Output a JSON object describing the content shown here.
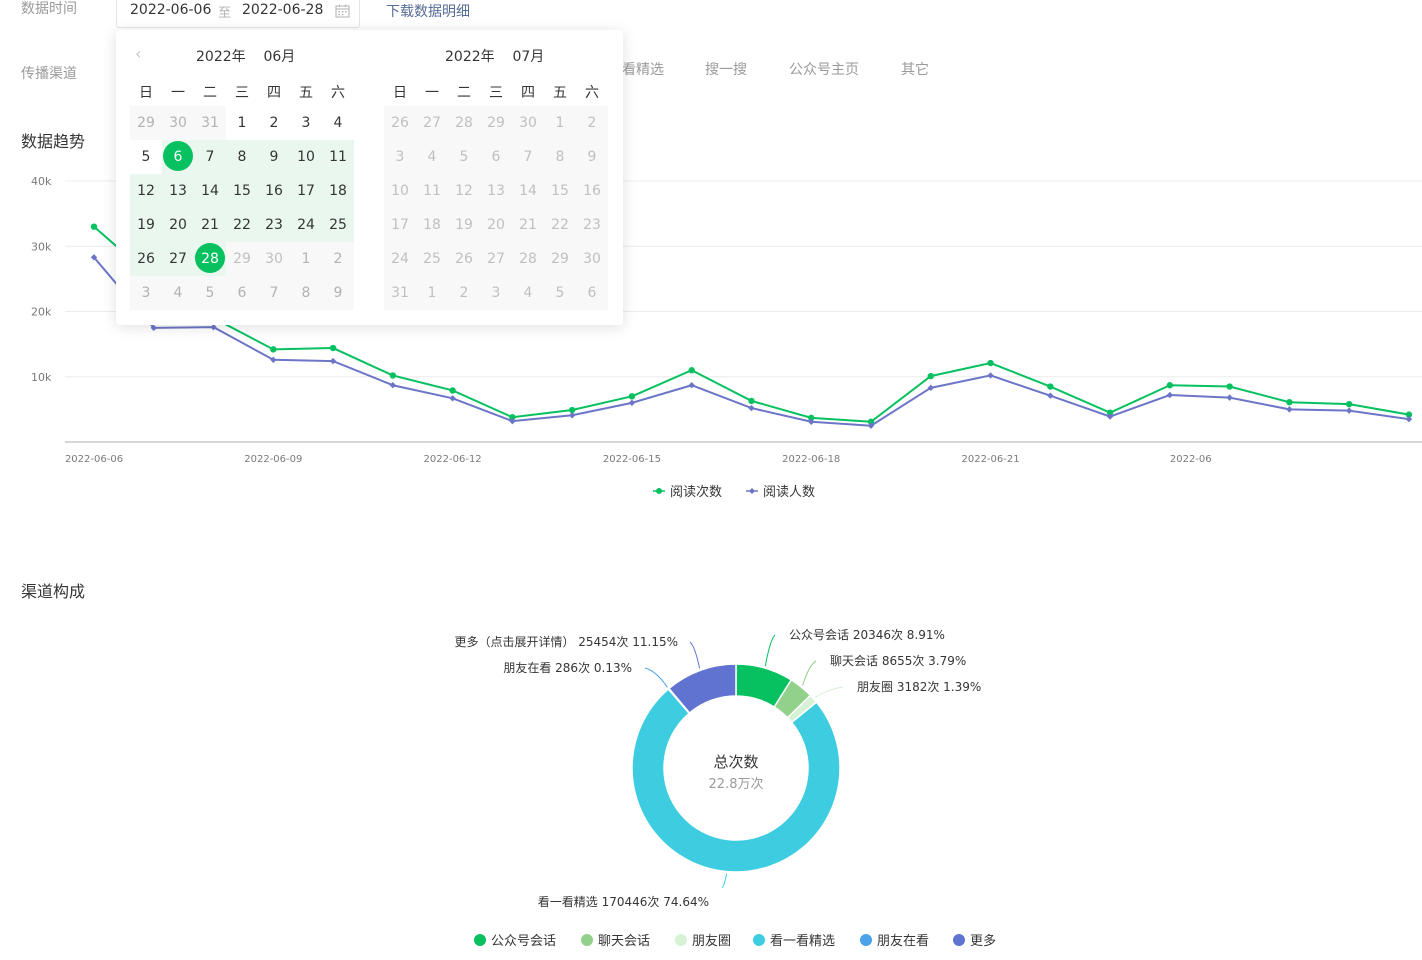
{
  "filters": {
    "date_label": "数据时间",
    "date_start": "2022-06-06",
    "date_separator": "至",
    "date_end": "2022-06-28",
    "download_link": "下载数据明细",
    "channel_label": "传播渠道",
    "channel_tabs": [
      "看精选",
      "搜一搜",
      "公众号主页",
      "其它"
    ]
  },
  "calendar": {
    "left_header": {
      "year": "2022年",
      "month": "06月"
    },
    "right_header": {
      "year": "2022年",
      "month": "07月"
    },
    "weekdays": [
      "日",
      "一",
      "二",
      "三",
      "四",
      "五",
      "六"
    ],
    "left_days": [
      "29",
      "30",
      "31",
      "1",
      "2",
      "3",
      "4",
      "5",
      "6",
      "7",
      "8",
      "9",
      "10",
      "11",
      "12",
      "13",
      "14",
      "15",
      "16",
      "17",
      "18",
      "19",
      "20",
      "21",
      "22",
      "23",
      "24",
      "25",
      "26",
      "27",
      "28",
      "29",
      "30",
      "1",
      "2",
      "3",
      "4",
      "5",
      "6",
      "7",
      "8",
      "9"
    ],
    "right_days": [
      "26",
      "27",
      "28",
      "29",
      "30",
      "1",
      "2",
      "3",
      "4",
      "5",
      "6",
      "7",
      "8",
      "9",
      "10",
      "11",
      "12",
      "13",
      "14",
      "15",
      "16",
      "17",
      "18",
      "19",
      "20",
      "21",
      "22",
      "23",
      "24",
      "25",
      "26",
      "27",
      "28",
      "29",
      "30",
      "31",
      "1",
      "2",
      "3",
      "4",
      "5",
      "6"
    ],
    "selected_start": "6",
    "selected_end": "28"
  },
  "trend": {
    "title": "数据趋势"
  },
  "composition": {
    "title": "渠道构成",
    "center_title": "总次数",
    "center_value": "22.8万次"
  },
  "colors": {
    "green": "#07c160",
    "purple": "#6c75c7",
    "light_green": "#91d18b",
    "pale_green": "#d6f1d4",
    "cyan": "#3ecde0",
    "blue": "#4aa3e8",
    "indigo": "#6173d0"
  },
  "chart_data": [
    {
      "type": "line",
      "x": [
        "2022-06-06",
        "2022-06-07",
        "2022-06-08",
        "2022-06-09",
        "2022-06-10",
        "2022-06-11",
        "2022-06-12",
        "2022-06-13",
        "2022-06-14",
        "2022-06-15",
        "2022-06-16",
        "2022-06-17",
        "2022-06-18",
        "2022-06-19",
        "2022-06-20",
        "2022-06-21",
        "2022-06-22",
        "2022-06-23",
        "2022-06-24",
        "2022-06-25",
        "2022-06-26",
        "2022-06-27",
        "2022-06-28"
      ],
      "x_tick_labels": [
        "2022-06-06",
        "2022-06-09",
        "2022-06-12",
        "2022-06-15",
        "2022-06-18",
        "2022-06-21",
        "2022-06"
      ],
      "y_tick_labels": [
        "10k",
        "20k",
        "30k",
        "40k"
      ],
      "ylim": [
        0,
        40000
      ],
      "series": [
        {
          "name": "阅读次数",
          "values": [
            33000,
            25000,
            19000,
            14200,
            14400,
            10200,
            7900,
            3800,
            4900,
            7000,
            11000,
            6300,
            3700,
            3100,
            10100,
            12100,
            8500,
            4500,
            8700,
            8500,
            6100,
            5800,
            4200
          ]
        },
        {
          "name": "阅读人数",
          "values": [
            28300,
            17500,
            17600,
            12600,
            12400,
            8700,
            6700,
            3200,
            4100,
            6000,
            8700,
            5200,
            3100,
            2500,
            8300,
            10200,
            7100,
            3900,
            7200,
            6800,
            5000,
            4800,
            3500
          ]
        }
      ]
    },
    {
      "type": "pie",
      "categories": [
        "公众号会话",
        "聊天会话",
        "朋友圈",
        "看一看精选",
        "朋友在看",
        "更多"
      ],
      "values": [
        20346,
        8655,
        3182,
        170446,
        286,
        25454
      ],
      "labels": [
        "公众号会话 20346次 8.91%",
        "聊天会话 8655次 3.79%",
        "朋友圈 3182次 1.39%",
        "看一看精选 170446次 74.64%",
        "朋友在看 286次 0.13%",
        "更多（点击展开详情） 25454次 11.15%"
      ]
    }
  ]
}
